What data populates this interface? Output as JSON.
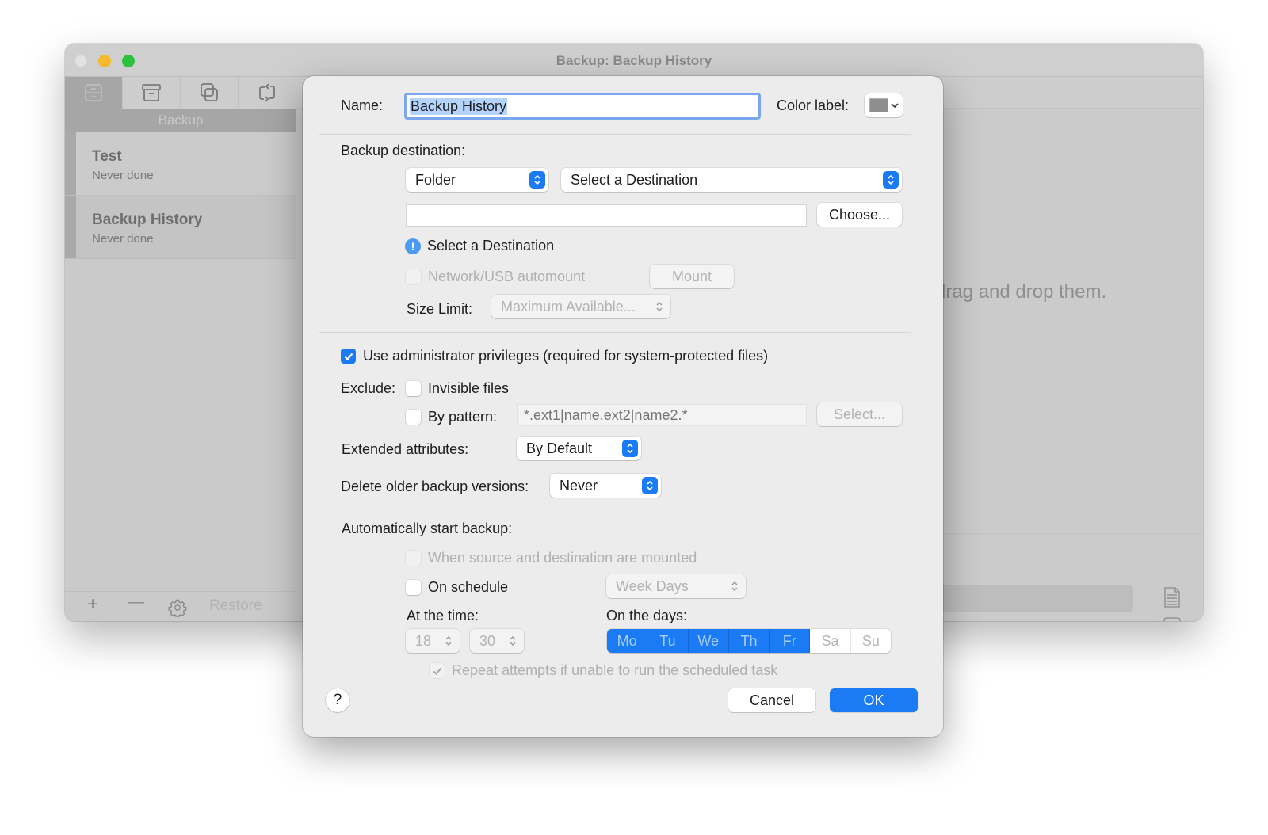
{
  "window": {
    "title": "Backup: Backup History",
    "sidebar": {
      "tabs": [
        {
          "name": "backup-tab",
          "icon": "drawer-icon",
          "active": true
        },
        {
          "name": "archive-tab",
          "icon": "archive-box-icon",
          "active": false
        },
        {
          "name": "copy-tab",
          "icon": "duplicate-icon",
          "active": false
        },
        {
          "name": "sync-tab",
          "icon": "sync-icon",
          "active": false
        }
      ],
      "caption": "Backup",
      "jobs": [
        {
          "name": "Test",
          "status": "Never done"
        },
        {
          "name": "Backup History",
          "status": "Never done"
        }
      ],
      "footer": {
        "add": "+",
        "remove": "—",
        "restore_label": "Restore"
      }
    },
    "main": {
      "hint_visible": "drag and drop them."
    }
  },
  "sheet": {
    "name_label": "Name:",
    "name_value": "Backup History",
    "color_label": "Color label:",
    "color_value": "#8e8e8e",
    "destination": {
      "label": "Backup destination:",
      "type_selected": "Folder",
      "destination_selected": "Select a Destination",
      "path_value": "",
      "choose_label": "Choose...",
      "warning": "Select a Destination",
      "automount_label": "Network/USB automount",
      "automount_checked": false,
      "mount_label": "Mount",
      "size_limit_label": "Size Limit:",
      "size_limit_selected": "Maximum Available..."
    },
    "options": {
      "admin_label": "Use administrator privileges (required for system-protected files)",
      "admin_checked": true,
      "exclude_label": "Exclude:",
      "invisible_label": "Invisible files",
      "invisible_checked": false,
      "pattern_label": "By pattern:",
      "pattern_checked": false,
      "pattern_placeholder": "*.ext1|name.ext2|name2.*",
      "select_label": "Select...",
      "ext_attr_label": "Extended attributes:",
      "ext_attr_selected": "By Default",
      "delete_label": "Delete older backup versions:",
      "delete_selected": "Never"
    },
    "schedule": {
      "label": "Automatically start backup:",
      "mounted_label": "When source and destination are mounted",
      "mounted_checked": false,
      "on_schedule_label": "On schedule",
      "on_schedule_checked": false,
      "frequency_selected": "Week Days",
      "time_label": "At the time:",
      "hour": "18",
      "minute": "30",
      "days_label": "On the days:",
      "days": [
        {
          "label": "Mo",
          "on": true
        },
        {
          "label": "Tu",
          "on": true
        },
        {
          "label": "We",
          "on": true
        },
        {
          "label": "Th",
          "on": true
        },
        {
          "label": "Fr",
          "on": true
        },
        {
          "label": "Sa",
          "on": false
        },
        {
          "label": "Su",
          "on": false
        }
      ],
      "repeat_label": "Repeat attempts if unable to run the scheduled task",
      "repeat_checked": true
    },
    "buttons": {
      "help": "?",
      "cancel": "Cancel",
      "ok": "OK"
    }
  }
}
